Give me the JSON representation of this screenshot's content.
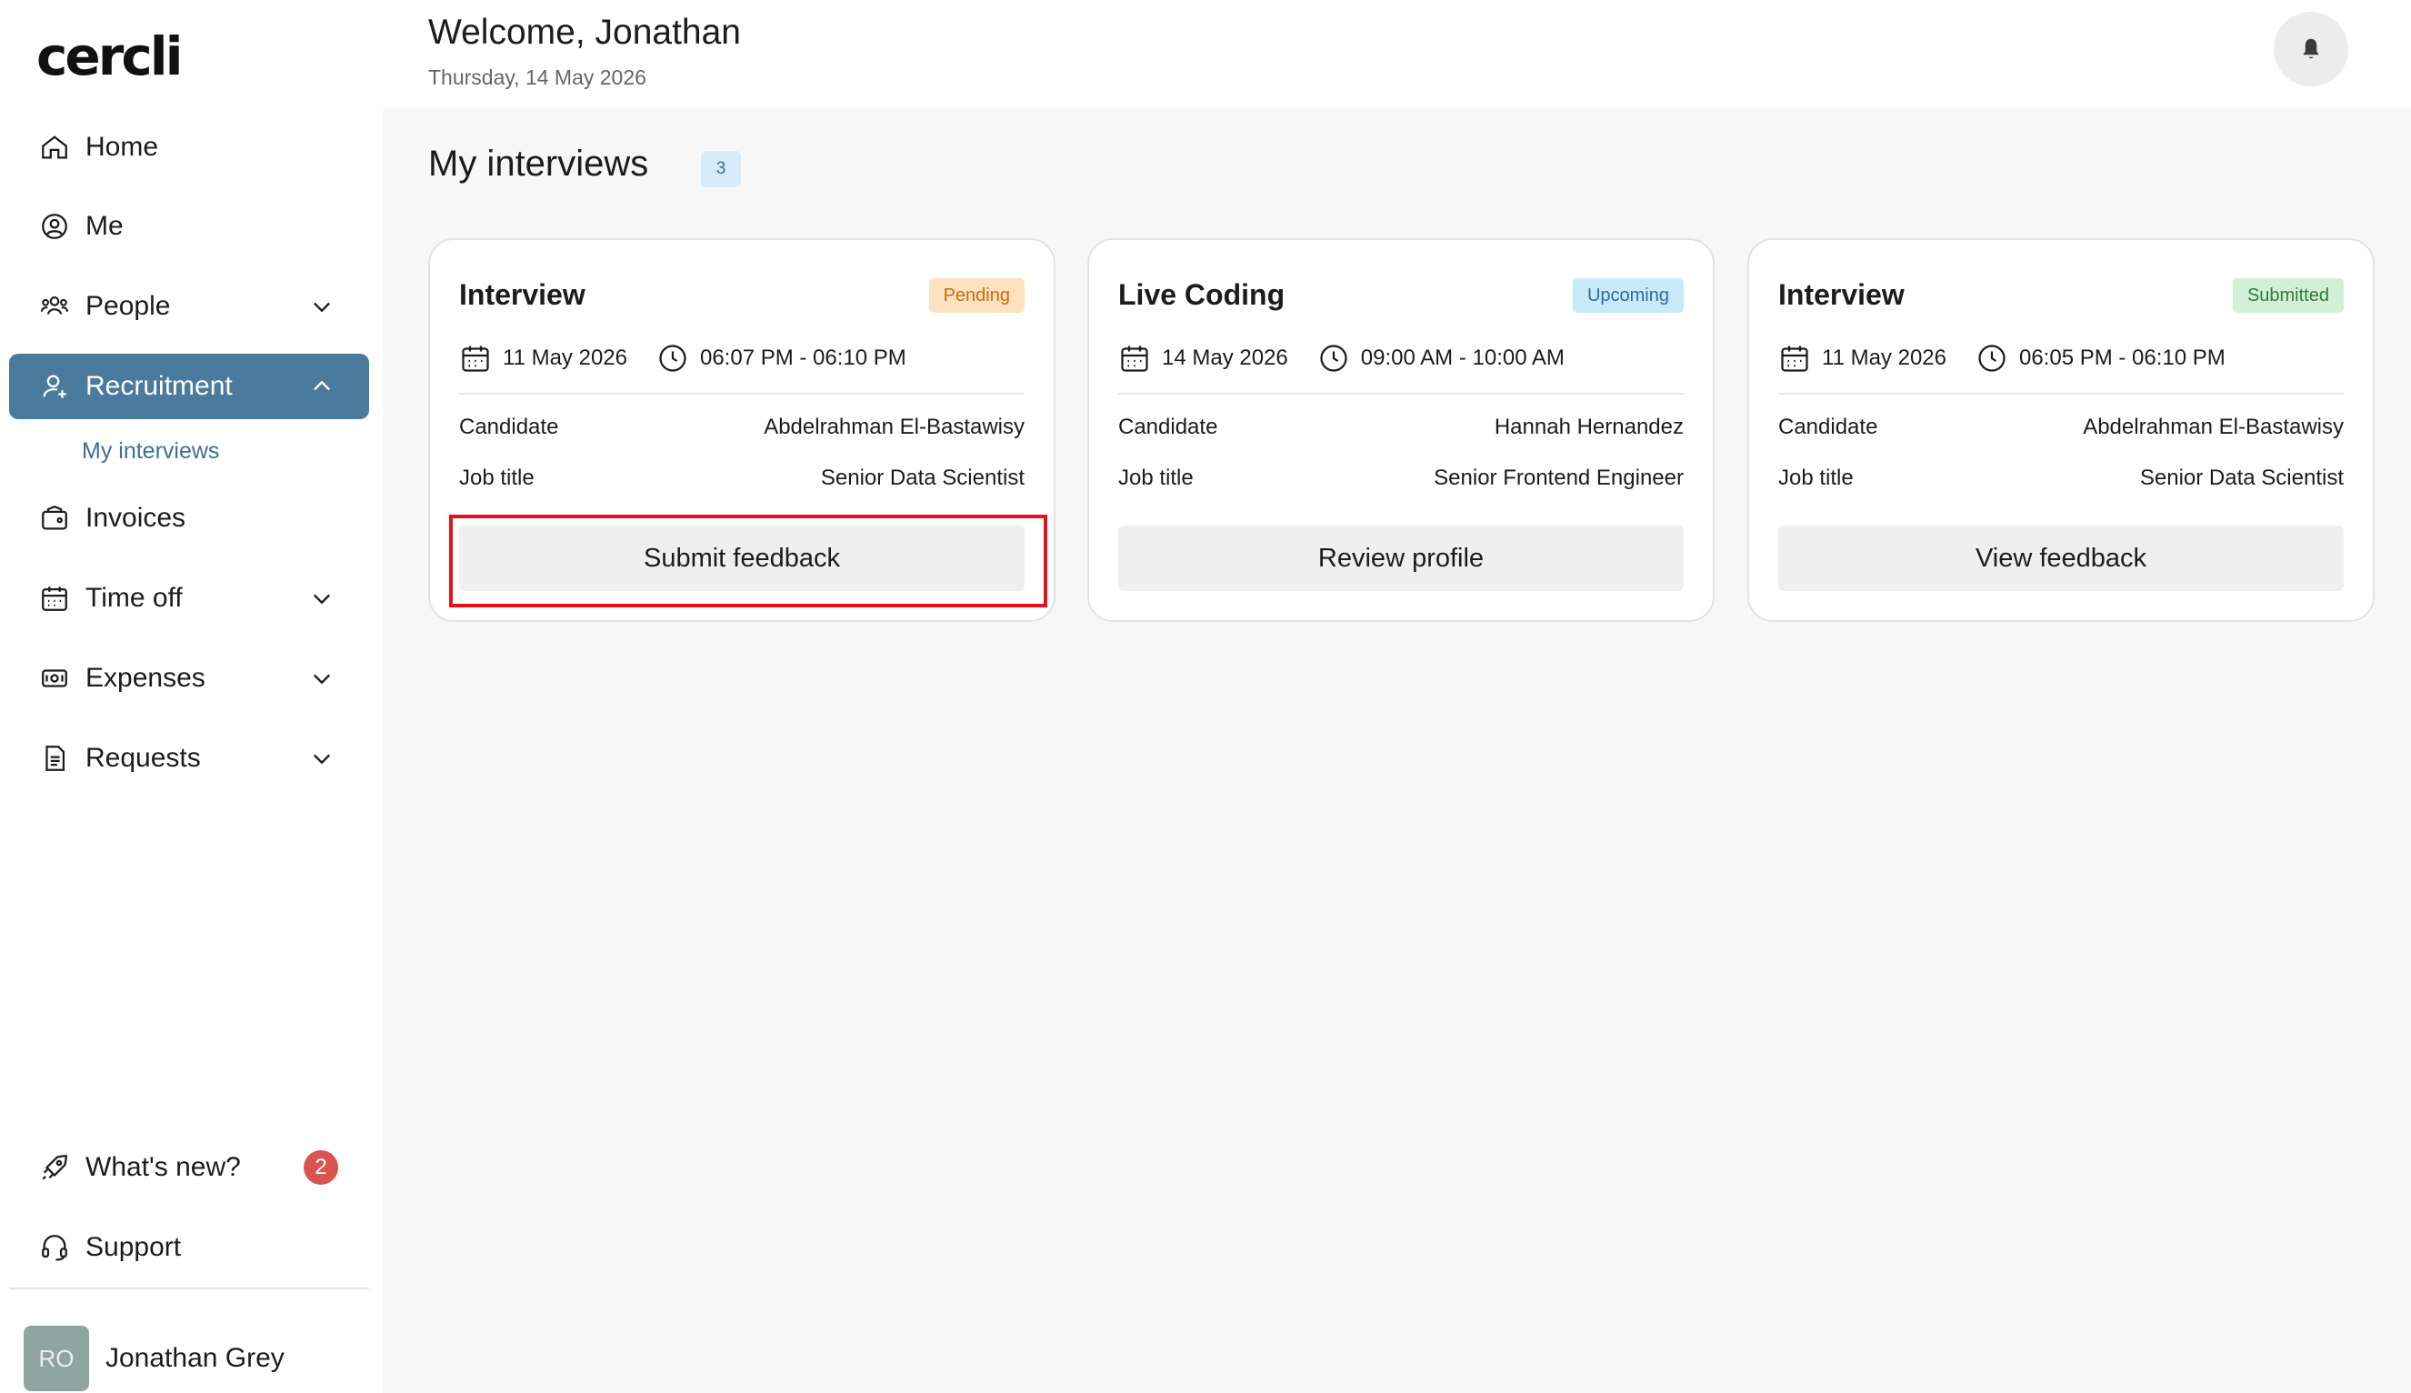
{
  "app": {
    "logo": "cercli"
  },
  "sidebar": {
    "items": [
      {
        "label": "Home",
        "icon": "home-icon"
      },
      {
        "label": "Me",
        "icon": "user-circle-icon"
      },
      {
        "label": "People",
        "icon": "people-icon"
      },
      {
        "label": "Recruitment",
        "icon": "recruit-icon",
        "active": true
      },
      {
        "label": "Invoices",
        "icon": "invoice-icon"
      },
      {
        "label": "Time off",
        "icon": "calendar-icon"
      },
      {
        "label": "Expenses",
        "icon": "money-icon"
      },
      {
        "label": "Requests",
        "icon": "document-icon"
      },
      {
        "label": "What's new?",
        "icon": "rocket-icon",
        "badge": "2"
      },
      {
        "label": "Support",
        "icon": "headset-icon"
      }
    ],
    "sub_item": "My interviews",
    "user": {
      "initials": "RO",
      "name": "Jonathan Grey"
    }
  },
  "header": {
    "welcome": "Welcome, Jonathan",
    "date": "Thursday, 14 May 2026"
  },
  "main": {
    "title": "My interviews",
    "count": "3",
    "cards": [
      {
        "title": "Interview",
        "status": "Pending",
        "date": "11 May 2026",
        "time": "06:07 PM - 06:10 PM",
        "candidate_label": "Candidate",
        "candidate": "Abdelrahman El-Bastawisy",
        "job_label": "Job title",
        "job": "Senior Data Scientist",
        "action": "Submit feedback"
      },
      {
        "title": "Live Coding",
        "status": "Upcoming",
        "date": "14 May 2026",
        "time": "09:00 AM - 10:00 AM",
        "candidate_label": "Candidate",
        "candidate": "Hannah Hernandez",
        "job_label": "Job title",
        "job": "Senior Frontend Engineer",
        "action": "Review profile"
      },
      {
        "title": "Interview",
        "status": "Submitted",
        "date": "11 May 2026",
        "time": "06:05 PM - 06:10 PM",
        "candidate_label": "Candidate",
        "candidate": "Abdelrahman El-Bastawisy",
        "job_label": "Job title",
        "job": "Senior Data Scientist",
        "action": "View feedback"
      }
    ]
  },
  "colors": {
    "accent": "#4a7b9d",
    "pending": "#cc6a10",
    "upcoming": "#2b6e9a",
    "submitted": "#2f7d3b",
    "highlight": "#e5121b"
  }
}
